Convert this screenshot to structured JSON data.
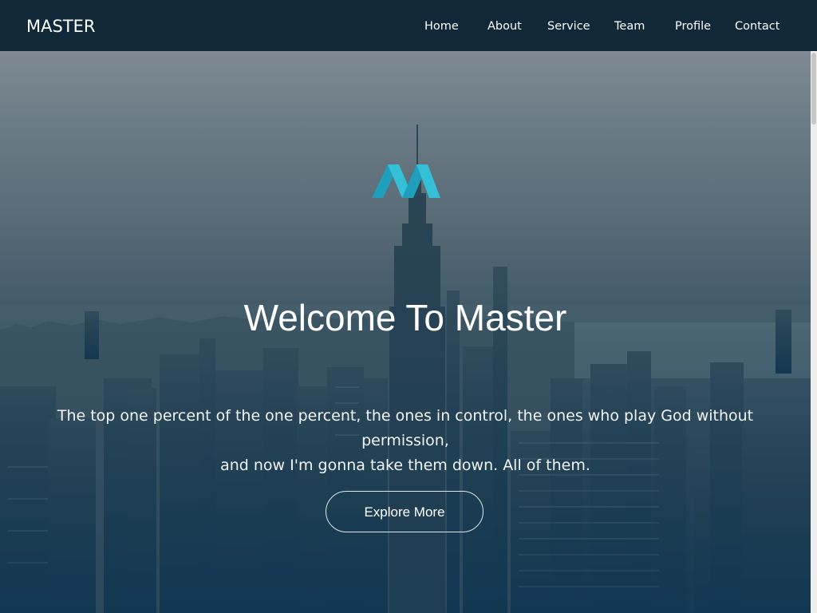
{
  "brand": "MASTER",
  "nav": {
    "items": [
      "Home",
      "About",
      "Service",
      "Team",
      "Profile",
      "Contact"
    ]
  },
  "hero": {
    "logo_icon": "master-m-logo-icon",
    "title": "Welcome To Master",
    "tagline_line1": "The top one percent of the one percent, the ones in control, the ones who play God without permission,",
    "tagline_line2": "and now I'm gonna take them down. All of them.",
    "cta_label": "Explore More"
  },
  "colors": {
    "navbar": "#112838",
    "logo_teal": "#29b6cf",
    "overlay_top": "#7a8791",
    "overlay_bottom": "#123a52"
  }
}
